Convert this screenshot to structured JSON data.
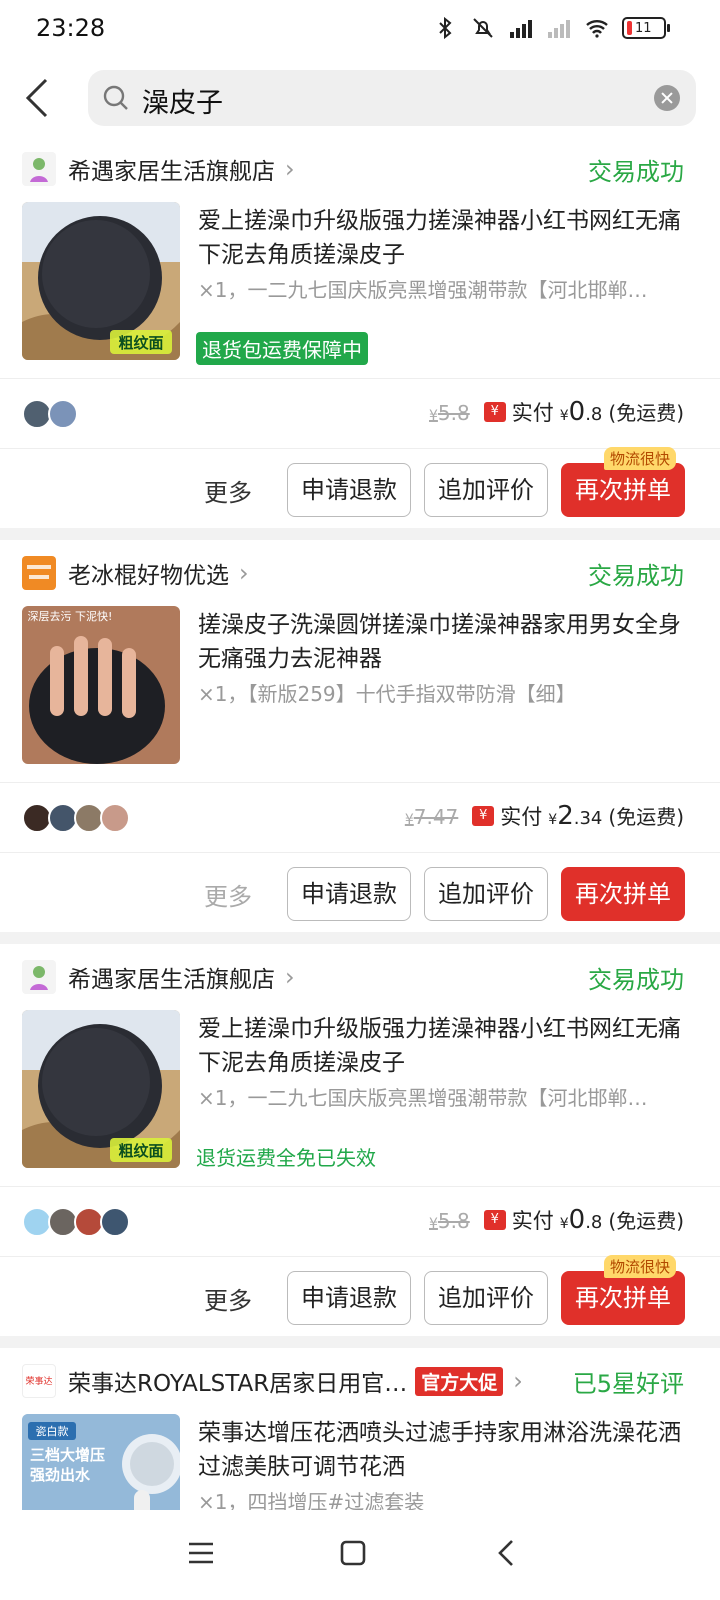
{
  "status_bar": {
    "time": "23:28",
    "battery": "11"
  },
  "search": {
    "query": "澡皮子"
  },
  "orders": [
    {
      "shop_name": "希遇家居生活旗舰店",
      "shop_tag": "",
      "status": "交易成功",
      "title": "爱上搓澡巾升级版强力搓澡神器小红书网红无痛下泥去角质搓澡皮子",
      "spec": "×1，一二九七国庆版亮黑增强潮带款【河北邯郸…",
      "guarantee": "退货包运费保障中",
      "original_price": "5.8",
      "pay_label": "实付",
      "pay_int": "0",
      "pay_dec": ".8",
      "shipping": "(免运费)",
      "more": "更多",
      "refund": "申请退款",
      "review": "追加评价",
      "reorder": "再次拼单",
      "badge": "物流很快",
      "image_text": "粗纹面"
    },
    {
      "shop_name": "老冰棍好物优选",
      "shop_tag": "",
      "status": "交易成功",
      "title": "搓澡皮子洗澡圆饼搓澡巾搓澡神器家用男女全身无痛强力去泥神器",
      "spec": "×1，【新版259】十代手指双带防滑【细】",
      "guarantee": "",
      "original_price": "7.47",
      "pay_label": "实付",
      "pay_int": "2",
      "pay_dec": ".34",
      "shipping": "(免运费)",
      "more": "更多",
      "refund": "申请退款",
      "review": "追加评价",
      "reorder": "再次拼单",
      "badge": "",
      "image_text": "深层去污 下泥快!"
    },
    {
      "shop_name": "希遇家居生活旗舰店",
      "shop_tag": "",
      "status": "交易成功",
      "title": "爱上搓澡巾升级版强力搓澡神器小红书网红无痛下泥去角质搓澡皮子",
      "spec": "×1，一二九七国庆版亮黑增强潮带款【河北邯郸…",
      "guarantee": "退货运费全免已失效",
      "original_price": "5.8",
      "pay_label": "实付",
      "pay_int": "0",
      "pay_dec": ".8",
      "shipping": "(免运费)",
      "more": "更多",
      "refund": "申请退款",
      "review": "追加评价",
      "reorder": "再次拼单",
      "badge": "物流很快",
      "image_text": "粗纹面"
    },
    {
      "shop_name": "荣事达ROYALSTAR居家日用官…",
      "shop_tag": "官方大促",
      "status": "已5星好评",
      "title": "荣事达增压花洒喷头过滤手持家用淋浴洗澡花洒过滤美肤可调节花洒",
      "spec": "×1，四挡增压#过滤套装",
      "image_text_1": "瓷白款",
      "image_text_2": "三档大增压",
      "image_text_3": "强劲出水",
      "logo_text": "荣事达"
    }
  ],
  "colors": {
    "green": "#2aa845",
    "red": "#e0302a"
  }
}
